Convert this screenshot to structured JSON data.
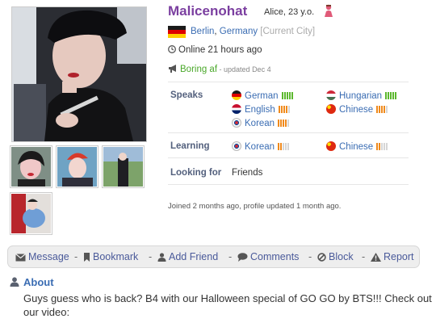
{
  "profile": {
    "username": "Malicenohat",
    "name_age": "Alice, 23 y.o.",
    "gender_icon": "female-icon",
    "location": {
      "city": "Berlin",
      "separator": ", ",
      "country": "Germany",
      "tag": "[Current City]",
      "flag": "flag-germany-icon"
    },
    "online_status": "Online 21 hours ago",
    "mood": {
      "text": "Boring af",
      "updated": " - updated Dec 4"
    },
    "joined": "Joined 2 months ago, profile updated 1 month ago."
  },
  "details": {
    "speaks_label": "Speaks",
    "speaks": [
      {
        "name": "German",
        "flag": "flag-germany-icon",
        "level": 5,
        "level_color": "#5cb82e"
      },
      {
        "name": "Hungarian",
        "flag": "flag-hungary-icon",
        "level": 5,
        "level_color": "#5cb82e"
      },
      {
        "name": "English",
        "flag": "flag-uk-icon",
        "level": 4,
        "level_color": "#f08a1c"
      },
      {
        "name": "Chinese",
        "flag": "flag-china-icon",
        "level": 4,
        "level_color": "#f08a1c"
      },
      {
        "name": "Korean",
        "flag": "flag-korea-icon",
        "level": 4,
        "level_color": "#f08a1c"
      }
    ],
    "learning_label": "Learning",
    "learning": [
      {
        "name": "Korean",
        "flag": "flag-korea-icon",
        "level": 2,
        "level_color": "#f08a1c"
      },
      {
        "name": "Chinese",
        "flag": "flag-china-icon",
        "level": 2,
        "level_color": "#f08a1c"
      }
    ],
    "looking_for_label": "Looking for",
    "looking_for": "Friends"
  },
  "actions": [
    {
      "label": "Message",
      "icon": "envelope-icon"
    },
    {
      "label": "Bookmark",
      "icon": "bookmark-icon"
    },
    {
      "label": "Add Friend",
      "icon": "add-user-icon"
    },
    {
      "label": "Comments",
      "icon": "speech-bubble-icon"
    },
    {
      "label": "Block",
      "icon": "block-icon"
    },
    {
      "label": "Report",
      "icon": "warning-icon"
    }
  ],
  "action_separator": "-",
  "about": {
    "title": "About",
    "text": "Guys guess who is back? B4 with our Halloween special of GO GO by BTS!!! Check out our video:"
  },
  "colors": {
    "username": "#7b3fa0",
    "link": "#3b6db3",
    "mood": "#4aa82a",
    "label": "#53607d",
    "action_bar_bg": "#eeeeee"
  }
}
